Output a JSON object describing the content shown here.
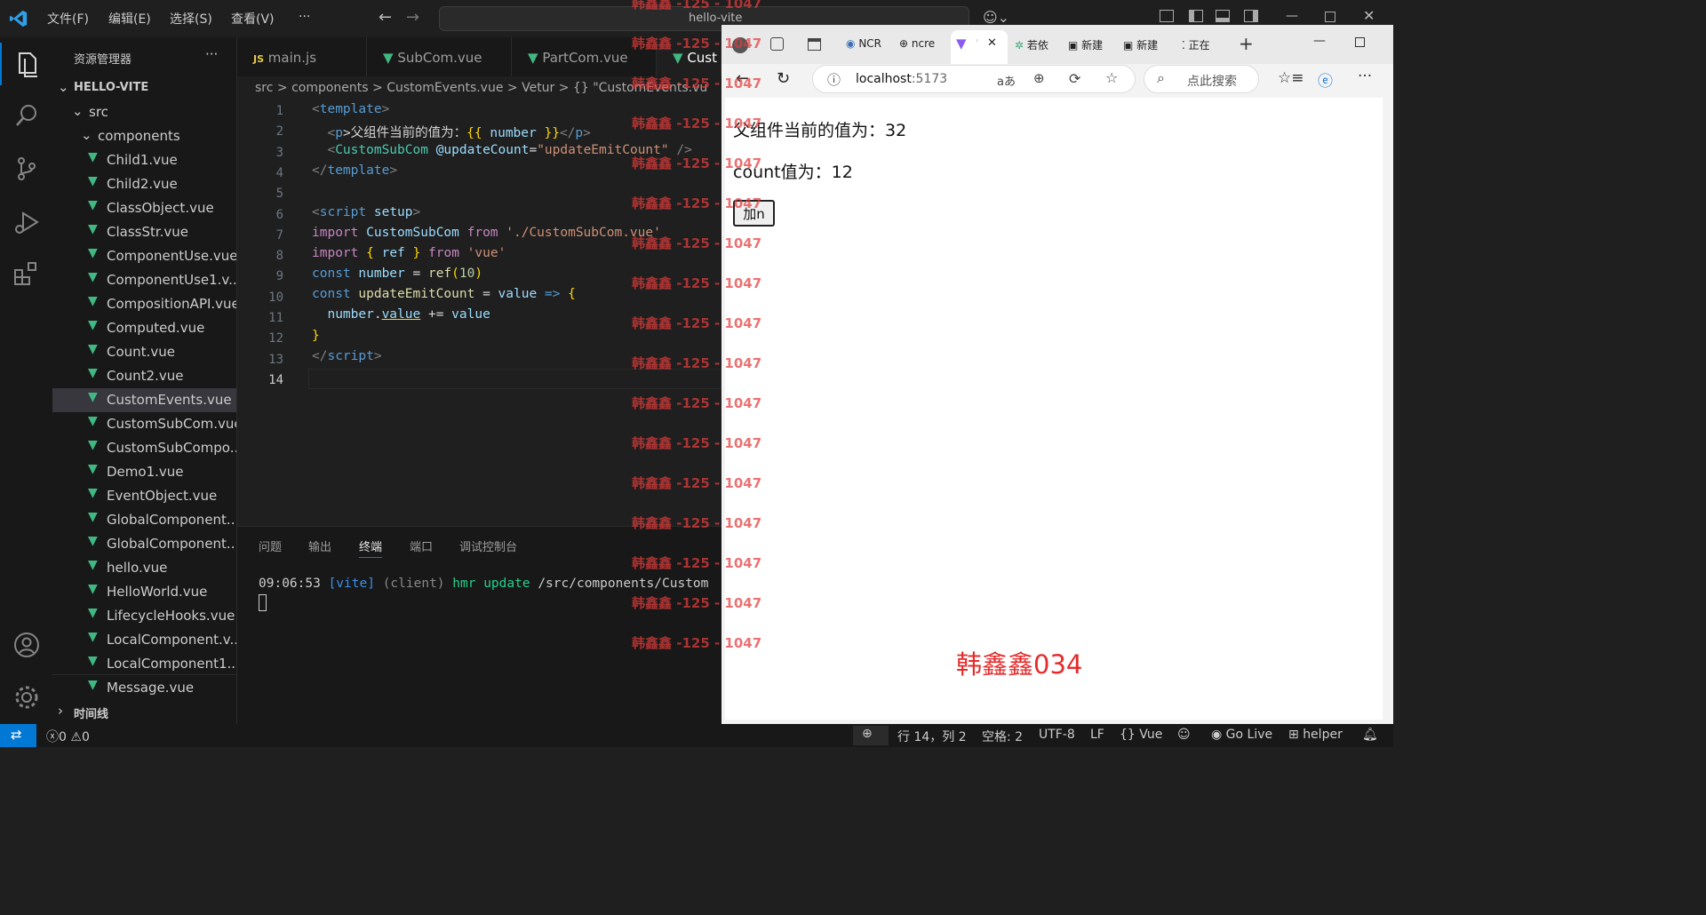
{
  "titlebar": {
    "menus": [
      "文件(F)",
      "编辑(E)",
      "选择(S)",
      "查看(V)",
      "···"
    ],
    "command_center": "hello-vite"
  },
  "sidebar": {
    "title": "资源管理器",
    "more": "···",
    "project": "HELLO-VITE",
    "folders": [
      "src",
      "components"
    ],
    "files": [
      "Child1.vue",
      "Child2.vue",
      "ClassObject.vue",
      "ClassStr.vue",
      "ComponentUse.vue",
      "ComponentUse1.v...",
      "CompositionAPI.vue",
      "Computed.vue",
      "Count.vue",
      "Count2.vue",
      "CustomEvents.vue",
      "CustomSubCom.vue",
      "CustomSubCompo...",
      "Demo1.vue",
      "EventObject.vue",
      "GlobalComponent....",
      "GlobalComponent...",
      "hello.vue",
      "HelloWorld.vue",
      "LifecycleHooks.vue",
      "LocalComponent.v...",
      "LocalComponent1....",
      "Message.vue"
    ],
    "selected_file": "CustomEvents.vue",
    "timeline": "时间线"
  },
  "editor": {
    "tabs": [
      {
        "icon": "JS",
        "label": "main.js"
      },
      {
        "label": "SubCom.vue"
      },
      {
        "label": "PartCom.vue"
      },
      {
        "label": "Cust"
      }
    ],
    "breadcrumb": "src > components > CustomEvents.vue > Vetur > {} \"CustomEvents.vu",
    "line_numbers": [
      "1",
      "2",
      "3",
      "4",
      "5",
      "6",
      "7",
      "8",
      "9",
      "10",
      "11",
      "12",
      "13",
      "14"
    ],
    "code": {
      "l1": {
        "a": "<",
        "b": "template",
        "c": ">"
      },
      "l2": {
        "a": "  <",
        "b": "p",
        "c": ">父组件当前的值为：",
        "d": "{{",
        "e": " number ",
        "f": "}}",
        "g": "</",
        "h": "p",
        "i": ">"
      },
      "l3": {
        "a": "  <",
        "b": "CustomSubCom",
        "c": " @updateCount",
        "d": "=",
        "e": "\"updateEmitCount\"",
        "f": " />"
      },
      "l4": {
        "a": "</",
        "b": "template",
        "c": ">"
      },
      "l6": {
        "a": "<",
        "b": "script",
        "c": " setup",
        "d": ">"
      },
      "l7": {
        "a": "import",
        "b": " CustomSubCom ",
        "c": "from",
        "d": " './CustomSubCom.vue'"
      },
      "l8": {
        "a": "import",
        "b": " { ",
        "c": "ref",
        "d": " } ",
        "e": "from",
        "f": " 'vue'"
      },
      "l9": {
        "a": "const",
        "b": " number ",
        "c": "= ",
        "d": "ref",
        "e": "(",
        "f": "10",
        "g": ")"
      },
      "l10": {
        "a": "const",
        "b": " updateEmitCount ",
        "c": "= ",
        "d": "value",
        "e": " => ",
        "f": "{"
      },
      "l11": {
        "a": "  number",
        "b": ".",
        "c": "value",
        "d": " += ",
        "e": "value"
      },
      "l12": {
        "a": "}"
      },
      "l13": {
        "a": "</",
        "b": "script",
        "c": ">"
      }
    }
  },
  "panel": {
    "tabs": [
      "问题",
      "输出",
      "终端",
      "端口",
      "调试控制台"
    ],
    "active_tab": "终端",
    "terminal": {
      "time": "09:06:53",
      "tag": "[vite]",
      "client": "(client)",
      "hmr": "hmr update",
      "path": "/src/components/Custom"
    }
  },
  "browser": {
    "tabs": [
      "NCR",
      "ncre",
      "'",
      "若依",
      "新建",
      "新建",
      "正在"
    ],
    "url_host": "localhost",
    "url_port": ":5173",
    "search_placeholder": "点此搜索",
    "page": {
      "parent_value_text": "父组件当前的值为：32",
      "count_text": "count值为：12",
      "button_label": "加n",
      "watermark": "韩鑫鑫034"
    }
  },
  "watermark_overlay": {
    "text": "韩鑫鑫 -125 - 1047",
    "repeats": 17
  },
  "statusbar": {
    "problems": "0",
    "warnings": "0",
    "position": "行 14，列 2",
    "spaces": "空格: 2",
    "encoding": "UTF-8",
    "eol": "LF",
    "language": "Vue",
    "golive": "Go Live",
    "helper": "helper"
  },
  "colors": {
    "accent": "#0078d4",
    "vue_green": "#41b883",
    "watermark_red": "#e23c3c"
  }
}
